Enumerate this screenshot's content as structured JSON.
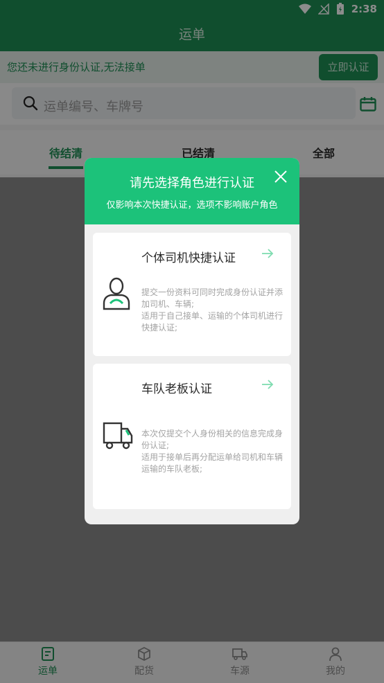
{
  "status_bar": {
    "time": "2:38"
  },
  "app_bar": {
    "title": "运单"
  },
  "notice": {
    "message": "您还未进行身份认证,无法接单",
    "button": "立即认证"
  },
  "search": {
    "placeholder": "运单编号、车牌号"
  },
  "tabs": [
    {
      "label": "待结清",
      "active": true
    },
    {
      "label": "已结清",
      "active": false
    },
    {
      "label": "全部",
      "active": false
    }
  ],
  "dialog": {
    "title": "请先选择角色进行认证",
    "subtitle": "仅影响本次快捷认证，选项不影响账户角色",
    "options": [
      {
        "title": "个体司机快捷认证",
        "icon": "driver-icon",
        "description": "提交一份资料可同时完成身份认证并添加司机、车辆;\n适用于自己接单、运输的个体司机进行快捷认证;"
      },
      {
        "title": "车队老板认证",
        "icon": "truck-icon",
        "description": "本次仅提交个人身份相关的信息完成身份认证;\n适用于接单后再分配运单给司机和车辆运输的车队老板;"
      }
    ]
  },
  "bottom_nav": [
    {
      "label": "运单",
      "icon": "waybill-icon",
      "active": true
    },
    {
      "label": "配货",
      "icon": "cargo-box-icon",
      "active": false
    },
    {
      "label": "车源",
      "icon": "truck-source-icon",
      "active": false
    },
    {
      "label": "我的",
      "icon": "profile-icon",
      "active": false
    }
  ],
  "colors": {
    "primary": "#1e8e55",
    "dialog_header": "#1cc27a",
    "accent_arrow": "#7fdcb0"
  }
}
